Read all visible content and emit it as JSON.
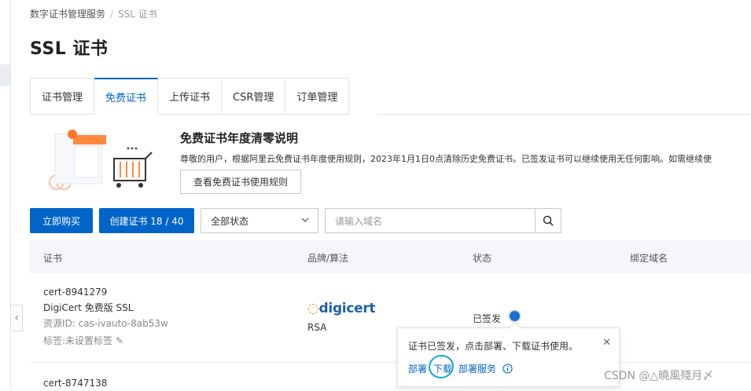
{
  "breadcrumb": {
    "parent": "数字证书管理服务",
    "separator": "/",
    "current": "SSL 证书"
  },
  "page_title": "SSL 证书",
  "tabs": [
    {
      "label": "证书管理",
      "active": false
    },
    {
      "label": "免费证书",
      "active": true
    },
    {
      "label": "上传证书",
      "active": false
    },
    {
      "label": "CSR管理",
      "active": false
    },
    {
      "label": "订单管理",
      "active": false
    }
  ],
  "banner": {
    "title": "免费证书年度清零说明",
    "text": "尊敬的用户，根据阿里云免费证书年度使用规则，2023年1月1日0点清除历史免费证书。已签发证书可以继续使用无任何影响。如需继续使",
    "button": "查看免费证书使用规则"
  },
  "toolbar": {
    "buy_label": "立即购买",
    "create_label": "创建证书 18 / 40",
    "status_select": "全部状态",
    "search_placeholder": "请输入域名"
  },
  "table": {
    "columns": [
      "证书",
      "品牌/算法",
      "状态",
      "绑定域名"
    ],
    "rows": [
      {
        "id": "cert-8941279",
        "name": "DigiCert 免费版 SSL",
        "resource_id": "资源ID: cas-ivauto-8ab53w",
        "tag": "标签:未设置标签",
        "brand": "digicert",
        "algorithm": "RSA",
        "status": "已签发"
      },
      {
        "id": "cert-8747138"
      }
    ]
  },
  "popover": {
    "message": "证书已签发，点击部署、下载证书使用。",
    "actions": [
      "部署",
      "下载",
      "部署服务"
    ]
  },
  "watermark": "CSDN @△曉風殘月〆",
  "colors": {
    "primary": "#0064c8",
    "header_bg": "#f5f6fa",
    "annotation": "#15a7c9"
  }
}
